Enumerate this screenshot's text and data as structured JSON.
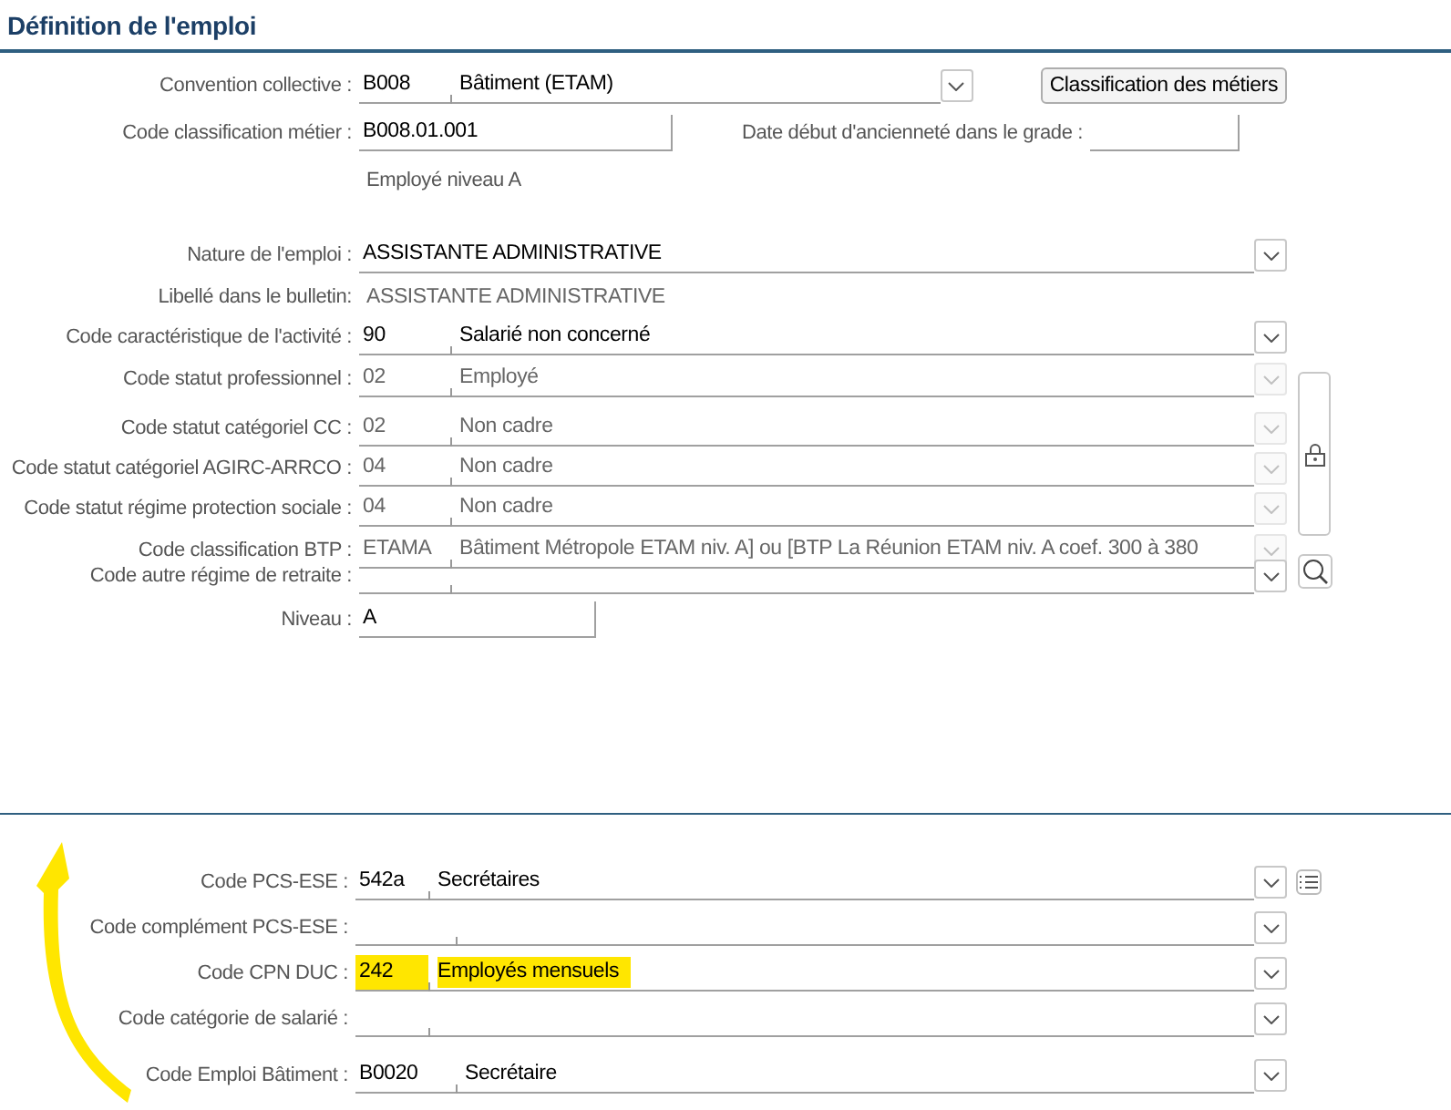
{
  "section_title": "Définition de l'emploi",
  "convention": {
    "label": "Convention collective :",
    "code": "B008",
    "name": "Bâtiment (ETAM)",
    "button": "Classification des métiers"
  },
  "classification": {
    "label": "Code classification métier :",
    "value": "B008.01.001",
    "date_label": "Date début d'ancienneté dans le grade :",
    "caption": "Employé niveau A"
  },
  "rows": [
    {
      "kind": "select",
      "label": "Nature de l'emploi :",
      "value": "ASSISTANTE ADMINISTRATIVE",
      "disabled": false
    },
    {
      "kind": "text",
      "label": "Libellé dans le bulletin:",
      "value": "ASSISTANTE ADMINISTRATIVE"
    },
    {
      "kind": "combo",
      "label": "Code caractéristique de l'activité :",
      "code": "90",
      "name": "Salarié non concerné",
      "disabled": false
    },
    {
      "kind": "combo",
      "label": "Code statut professionnel :",
      "code": "02",
      "name": "Employé",
      "disabled": true
    },
    {
      "kind": "combo",
      "label": "Code statut catégoriel CC :",
      "code": "02",
      "name": "Non cadre",
      "disabled": true
    },
    {
      "kind": "combo",
      "label": "Code statut catégoriel AGIRC-ARRCO :",
      "code": "04",
      "name": "Non cadre",
      "disabled": true
    },
    {
      "kind": "combo",
      "label": "Code statut régime protection sociale :",
      "code": "04",
      "name": "Non cadre",
      "disabled": true
    },
    {
      "kind": "combo",
      "label": "Code classification BTP :",
      "code": "ETAMA",
      "name": "Bâtiment Métropole ETAM niv. A] ou [BTP La Réunion ETAM niv. A coef. 300 à 380",
      "disabled": true
    },
    {
      "kind": "combo",
      "label": "Code autre régime de retraite :",
      "disabled": false
    },
    {
      "kind": "input",
      "label": "Niveau :",
      "value": "A"
    }
  ],
  "bottom_rows": [
    {
      "label": "Code PCS-ESE :",
      "code": "542a",
      "name": "Secrétaires",
      "highlighted": false
    },
    {
      "label": "Code complément PCS-ESE :",
      "highlighted": false
    },
    {
      "label": "Code CPN DUC :",
      "code": "242",
      "name": "Employés mensuels",
      "highlighted": true
    },
    {
      "label": "Code catégorie de salarié :",
      "highlighted": false
    },
    {
      "label": "Code Emploi Bâtiment :",
      "code": "B0020",
      "name": "Secrétaire",
      "highlighted": false
    }
  ]
}
